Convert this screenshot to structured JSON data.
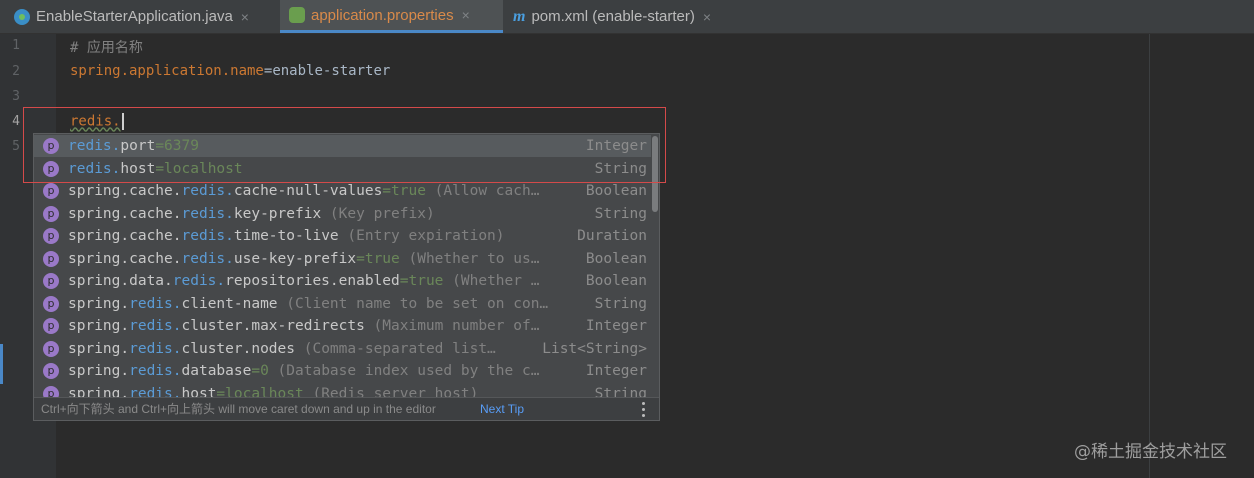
{
  "tabs": [
    {
      "label": "EnableStarterApplication.java",
      "icon": "java-class-icon",
      "active": false
    },
    {
      "label": "application.properties",
      "icon": "properties-file-icon",
      "active": true
    },
    {
      "label": "pom.xml (enable-starter)",
      "icon": "maven-icon",
      "active": false
    }
  ],
  "tab_close_glyph": "×",
  "gutter": {
    "line_numbers": [
      "1",
      "2",
      "3",
      "4",
      "5"
    ]
  },
  "editor": {
    "line1": "# 应用名称",
    "line2_key": "spring.application.name",
    "line2_eq": "=",
    "line2_val": "enable-starter",
    "line4_typed": "redis."
  },
  "completion": {
    "icon_letter": "p",
    "items": [
      {
        "pre": "",
        "match": "redis.",
        "post": "port",
        "default": "=6379",
        "desc": "",
        "type": "Integer"
      },
      {
        "pre": "",
        "match": "redis.",
        "post": "host",
        "default": "=localhost",
        "desc": "",
        "type": "String"
      },
      {
        "pre": "spring.cache.",
        "match": "redis.",
        "post": "cache-null-values",
        "default": "=true",
        "desc": " (Allow cach…",
        "type": "Boolean"
      },
      {
        "pre": "spring.cache.",
        "match": "redis.",
        "post": "key-prefix",
        "default": "",
        "desc": " (Key prefix)",
        "type": "String"
      },
      {
        "pre": "spring.cache.",
        "match": "redis.",
        "post": "time-to-live",
        "default": "",
        "desc": " (Entry expiration)",
        "type": "Duration"
      },
      {
        "pre": "spring.cache.",
        "match": "redis.",
        "post": "use-key-prefix",
        "default": "=true",
        "desc": " (Whether to us…",
        "type": "Boolean"
      },
      {
        "pre": "spring.data.",
        "match": "redis.",
        "post": "repositories.enabled",
        "default": "=true",
        "desc": " (Whether …",
        "type": "Boolean"
      },
      {
        "pre": "spring.",
        "match": "redis.",
        "post": "client-name",
        "default": "",
        "desc": " (Client name to be set on con…",
        "type": "String"
      },
      {
        "pre": "spring.",
        "match": "redis.",
        "post": "cluster.max-redirects",
        "default": "",
        "desc": " (Maximum number of…",
        "type": "Integer"
      },
      {
        "pre": "spring.",
        "match": "redis.",
        "post": "cluster.nodes",
        "default": "",
        "desc": " (Comma-separated list…",
        "type": "List<String>"
      },
      {
        "pre": "spring.",
        "match": "redis.",
        "post": "database",
        "default": "=0",
        "desc": " (Database index used by the c…",
        "type": "Integer"
      },
      {
        "pre": "spring.",
        "match": "redis.",
        "post": "host",
        "default": "=localhost",
        "desc": " (Redis server host)",
        "type": "String"
      }
    ],
    "footer_text": "Ctrl+向下箭头 and Ctrl+向上箭头 will move caret down and up in the editor",
    "next_tip": "Next Tip"
  },
  "watermark": "@稀土掘金技术社区",
  "colors": {
    "accent": "#4a88c7",
    "highlight_border": "#d44a4a",
    "match": "#5b9bd5",
    "property_icon": "#9a79c8",
    "key": "#cc7832",
    "comment": "#808080"
  }
}
